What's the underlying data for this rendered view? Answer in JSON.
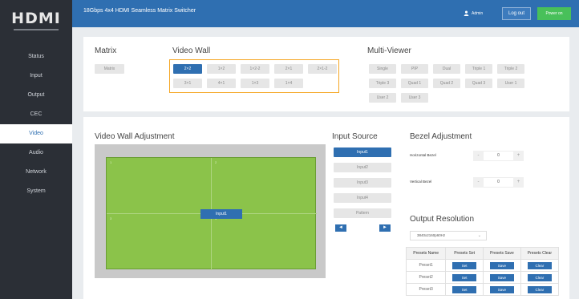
{
  "brand": {
    "logo_text": "HDMI"
  },
  "header": {
    "title": "18Gbps 4x4 HDMI Seamless Matrix Switcher",
    "user": "Admin",
    "logout_label": "Log out",
    "power_label": "Power on"
  },
  "sidebar": {
    "items": [
      {
        "label": "Status"
      },
      {
        "label": "Input"
      },
      {
        "label": "Output"
      },
      {
        "label": "CEC"
      },
      {
        "label": "Video",
        "active": true
      },
      {
        "label": "Audio"
      },
      {
        "label": "Network"
      },
      {
        "label": "System"
      }
    ]
  },
  "matrix": {
    "title": "Matrix",
    "button": "Matrix"
  },
  "video_wall": {
    "title": "Video Wall",
    "row1": [
      "2×2",
      "1×2",
      "1×2-2",
      "2×1",
      "2×1-2"
    ],
    "row2": [
      "3×1",
      "4×1",
      "1×3",
      "1×4"
    ],
    "selected": "2×2"
  },
  "multi_viewer": {
    "title": "Multi-Viewer",
    "row1": [
      "Single",
      "PIP",
      "Dual",
      "Triple 1",
      "Triple 2"
    ],
    "row2": [
      "Triple 3",
      "Quad 1",
      "Quad 2",
      "Quad 3",
      "User 1"
    ],
    "row3": [
      "User 2",
      "User 3"
    ]
  },
  "adjustment": {
    "title": "Video Wall Adjustment",
    "cell_labels": [
      "1",
      "2",
      "3",
      "4"
    ],
    "input_button": "Input1"
  },
  "input_source": {
    "title": "Input Source",
    "items": [
      "Input1",
      "Input2",
      "Input3",
      "Input4",
      "Pattern"
    ],
    "selected": "Input1",
    "prev_arrow": "◄",
    "next_arrow": "►"
  },
  "bezel": {
    "title": "Bezel Adjustment",
    "horizontal_label": "Horizontal Bezel",
    "horizontal_value": "0",
    "vertical_label": "Vertical Bezel",
    "vertical_value": "0",
    "minus": "-",
    "plus": "+"
  },
  "output_resolution": {
    "title": "Output Resolution",
    "selected": "3840x2160p60Hz"
  },
  "presets": {
    "headers": [
      "Presets Name",
      "Presets Set",
      "Presets Save",
      "Presets Clear"
    ],
    "rows": [
      {
        "name": "Preset1",
        "set": "Set",
        "save": "Save",
        "clear": "Clear"
      },
      {
        "name": "Preset2",
        "set": "Set",
        "save": "Save",
        "clear": "Clear"
      },
      {
        "name": "Preset3",
        "set": "Set",
        "save": "Save",
        "clear": "Clear"
      }
    ]
  },
  "colors": {
    "accent": "#2f6fb1",
    "sidebar": "#2b2f36",
    "power": "#48c05a",
    "wall": "#8bc34a",
    "highlight": "#f5a623"
  }
}
